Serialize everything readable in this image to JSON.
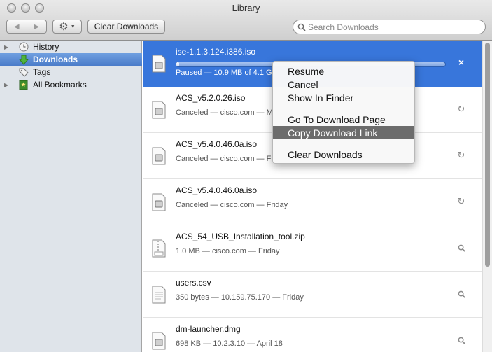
{
  "window": {
    "title": "Library"
  },
  "toolbar": {
    "back_icon": "back-arrow-icon",
    "forward_icon": "forward-arrow-icon",
    "gear_icon": "gear-icon",
    "clear_label": "Clear Downloads",
    "search_placeholder": "Search Downloads"
  },
  "sidebar": {
    "items": [
      {
        "label": "History",
        "icon": "clock-icon",
        "expandable": true
      },
      {
        "label": "Downloads",
        "icon": "download-arrow-icon",
        "selected": true
      },
      {
        "label": "Tags",
        "icon": "tag-icon"
      },
      {
        "label": "All Bookmarks",
        "icon": "bookmarks-icon",
        "expandable": true
      }
    ]
  },
  "downloads": [
    {
      "name": "ise-1.1.3.124.i386.iso",
      "meta": "Paused — 10.9 MB of 4.1 G",
      "progress": 0.01,
      "action": "×",
      "active": true
    },
    {
      "name": "ACS_v5.2.0.26.iso",
      "meta": "Canceled — cisco.com — M",
      "action": "↻"
    },
    {
      "name": "ACS_v5.4.0.46.0a.iso",
      "meta": "Canceled — cisco.com — Fr",
      "action": "↻"
    },
    {
      "name": "ACS_v5.4.0.46.0a.iso",
      "meta": "Canceled — cisco.com — Friday",
      "action": "↻"
    },
    {
      "name": "ACS_54_USB_Installation_tool.zip",
      "meta": "1.0 MB — cisco.com — Friday",
      "action": "🔍",
      "zip": true
    },
    {
      "name": "users.csv",
      "meta": "350 bytes — 10.159.75.170 — Friday",
      "action": "🔍"
    },
    {
      "name": "dm-launcher.dmg",
      "meta": "698 KB — 10.2.3.10 — April 18",
      "action": "🔍"
    }
  ],
  "context_menu": {
    "items": [
      "Resume",
      "Cancel",
      "Show In Finder",
      "Go To Download Page",
      "Copy Download Link",
      "Clear Downloads"
    ],
    "highlighted": "Copy Download Link"
  },
  "colors": {
    "selection": "#3876db",
    "menu_highlight": "#6c6c6c",
    "sidebar": "#dfe4ea"
  }
}
